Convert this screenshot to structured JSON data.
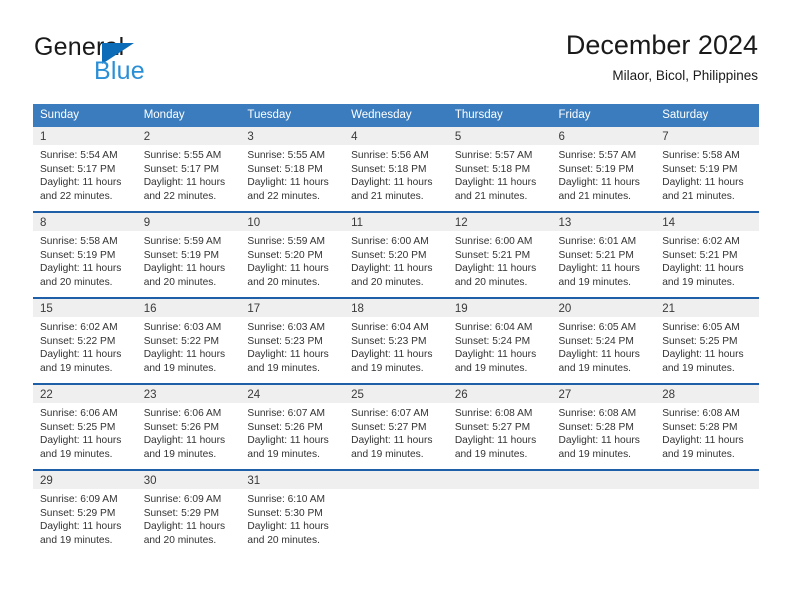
{
  "brand": {
    "name_part1": "General",
    "name_part2": "Blue",
    "accent_color": "#0d6cb8",
    "accent_light": "#2b8fd6"
  },
  "header": {
    "title": "December 2024",
    "location": "Milaor, Bicol, Philippines"
  },
  "theme": {
    "header_blue": "#3a7cbe",
    "separator_blue": "#1f5fa8",
    "day_band_gray": "#efefef"
  },
  "weekday_headers": [
    "Sunday",
    "Monday",
    "Tuesday",
    "Wednesday",
    "Thursday",
    "Friday",
    "Saturday"
  ],
  "weeks": [
    [
      {
        "day": "1",
        "sunrise": "Sunrise: 5:54 AM",
        "sunset": "Sunset: 5:17 PM",
        "daylight": "Daylight: 11 hours and 22 minutes."
      },
      {
        "day": "2",
        "sunrise": "Sunrise: 5:55 AM",
        "sunset": "Sunset: 5:17 PM",
        "daylight": "Daylight: 11 hours and 22 minutes."
      },
      {
        "day": "3",
        "sunrise": "Sunrise: 5:55 AM",
        "sunset": "Sunset: 5:18 PM",
        "daylight": "Daylight: 11 hours and 22 minutes."
      },
      {
        "day": "4",
        "sunrise": "Sunrise: 5:56 AM",
        "sunset": "Sunset: 5:18 PM",
        "daylight": "Daylight: 11 hours and 21 minutes."
      },
      {
        "day": "5",
        "sunrise": "Sunrise: 5:57 AM",
        "sunset": "Sunset: 5:18 PM",
        "daylight": "Daylight: 11 hours and 21 minutes."
      },
      {
        "day": "6",
        "sunrise": "Sunrise: 5:57 AM",
        "sunset": "Sunset: 5:19 PM",
        "daylight": "Daylight: 11 hours and 21 minutes."
      },
      {
        "day": "7",
        "sunrise": "Sunrise: 5:58 AM",
        "sunset": "Sunset: 5:19 PM",
        "daylight": "Daylight: 11 hours and 21 minutes."
      }
    ],
    [
      {
        "day": "8",
        "sunrise": "Sunrise: 5:58 AM",
        "sunset": "Sunset: 5:19 PM",
        "daylight": "Daylight: 11 hours and 20 minutes."
      },
      {
        "day": "9",
        "sunrise": "Sunrise: 5:59 AM",
        "sunset": "Sunset: 5:19 PM",
        "daylight": "Daylight: 11 hours and 20 minutes."
      },
      {
        "day": "10",
        "sunrise": "Sunrise: 5:59 AM",
        "sunset": "Sunset: 5:20 PM",
        "daylight": "Daylight: 11 hours and 20 minutes."
      },
      {
        "day": "11",
        "sunrise": "Sunrise: 6:00 AM",
        "sunset": "Sunset: 5:20 PM",
        "daylight": "Daylight: 11 hours and 20 minutes."
      },
      {
        "day": "12",
        "sunrise": "Sunrise: 6:00 AM",
        "sunset": "Sunset: 5:21 PM",
        "daylight": "Daylight: 11 hours and 20 minutes."
      },
      {
        "day": "13",
        "sunrise": "Sunrise: 6:01 AM",
        "sunset": "Sunset: 5:21 PM",
        "daylight": "Daylight: 11 hours and 19 minutes."
      },
      {
        "day": "14",
        "sunrise": "Sunrise: 6:02 AM",
        "sunset": "Sunset: 5:21 PM",
        "daylight": "Daylight: 11 hours and 19 minutes."
      }
    ],
    [
      {
        "day": "15",
        "sunrise": "Sunrise: 6:02 AM",
        "sunset": "Sunset: 5:22 PM",
        "daylight": "Daylight: 11 hours and 19 minutes."
      },
      {
        "day": "16",
        "sunrise": "Sunrise: 6:03 AM",
        "sunset": "Sunset: 5:22 PM",
        "daylight": "Daylight: 11 hours and 19 minutes."
      },
      {
        "day": "17",
        "sunrise": "Sunrise: 6:03 AM",
        "sunset": "Sunset: 5:23 PM",
        "daylight": "Daylight: 11 hours and 19 minutes."
      },
      {
        "day": "18",
        "sunrise": "Sunrise: 6:04 AM",
        "sunset": "Sunset: 5:23 PM",
        "daylight": "Daylight: 11 hours and 19 minutes."
      },
      {
        "day": "19",
        "sunrise": "Sunrise: 6:04 AM",
        "sunset": "Sunset: 5:24 PM",
        "daylight": "Daylight: 11 hours and 19 minutes."
      },
      {
        "day": "20",
        "sunrise": "Sunrise: 6:05 AM",
        "sunset": "Sunset: 5:24 PM",
        "daylight": "Daylight: 11 hours and 19 minutes."
      },
      {
        "day": "21",
        "sunrise": "Sunrise: 6:05 AM",
        "sunset": "Sunset: 5:25 PM",
        "daylight": "Daylight: 11 hours and 19 minutes."
      }
    ],
    [
      {
        "day": "22",
        "sunrise": "Sunrise: 6:06 AM",
        "sunset": "Sunset: 5:25 PM",
        "daylight": "Daylight: 11 hours and 19 minutes."
      },
      {
        "day": "23",
        "sunrise": "Sunrise: 6:06 AM",
        "sunset": "Sunset: 5:26 PM",
        "daylight": "Daylight: 11 hours and 19 minutes."
      },
      {
        "day": "24",
        "sunrise": "Sunrise: 6:07 AM",
        "sunset": "Sunset: 5:26 PM",
        "daylight": "Daylight: 11 hours and 19 minutes."
      },
      {
        "day": "25",
        "sunrise": "Sunrise: 6:07 AM",
        "sunset": "Sunset: 5:27 PM",
        "daylight": "Daylight: 11 hours and 19 minutes."
      },
      {
        "day": "26",
        "sunrise": "Sunrise: 6:08 AM",
        "sunset": "Sunset: 5:27 PM",
        "daylight": "Daylight: 11 hours and 19 minutes."
      },
      {
        "day": "27",
        "sunrise": "Sunrise: 6:08 AM",
        "sunset": "Sunset: 5:28 PM",
        "daylight": "Daylight: 11 hours and 19 minutes."
      },
      {
        "day": "28",
        "sunrise": "Sunrise: 6:08 AM",
        "sunset": "Sunset: 5:28 PM",
        "daylight": "Daylight: 11 hours and 19 minutes."
      }
    ],
    [
      {
        "day": "29",
        "sunrise": "Sunrise: 6:09 AM",
        "sunset": "Sunset: 5:29 PM",
        "daylight": "Daylight: 11 hours and 19 minutes."
      },
      {
        "day": "30",
        "sunrise": "Sunrise: 6:09 AM",
        "sunset": "Sunset: 5:29 PM",
        "daylight": "Daylight: 11 hours and 20 minutes."
      },
      {
        "day": "31",
        "sunrise": "Sunrise: 6:10 AM",
        "sunset": "Sunset: 5:30 PM",
        "daylight": "Daylight: 11 hours and 20 minutes."
      },
      {
        "day": "",
        "sunrise": "",
        "sunset": "",
        "daylight": ""
      },
      {
        "day": "",
        "sunrise": "",
        "sunset": "",
        "daylight": ""
      },
      {
        "day": "",
        "sunrise": "",
        "sunset": "",
        "daylight": ""
      },
      {
        "day": "",
        "sunrise": "",
        "sunset": "",
        "daylight": ""
      }
    ]
  ]
}
